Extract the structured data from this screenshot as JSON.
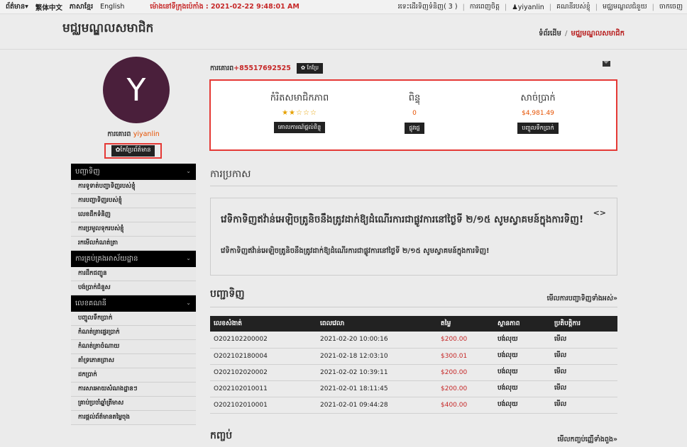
{
  "topbar": {
    "member_center": "ព័ត៌មាន▾",
    "lang_zh": "繁体中文",
    "lang_km": "ភាសាខ្មែរ",
    "lang_en": "English",
    "server_time": "ម៉ោងនៅទីក្រុងប៉េកាំង : 2021-02-22 9:48:01 AM",
    "cart": "រទេះដើរទិញទំនិញ( 3 )",
    "my_favorites": "ការពេញចិត្ត",
    "user": "yiyanlin",
    "account": "គណនីរបស់ខ្ញុំ",
    "service": "មជ្ឈមណ្ឌលជំនួយ",
    "logout": "ចាកចេញ"
  },
  "header": {
    "title": "មជ្ឈមណ្ឌលសមាជិក",
    "crumb_home": "ទំព័រដើម",
    "crumb_current": "មជ្ឈមណ្ឌលសមាជិក"
  },
  "profile": {
    "avatar_letter": "Y",
    "welcome": "ការគោរព",
    "username": "yiyanlin",
    "edit_label": "✿កែប្រែព័ត៌មាន",
    "phone_label": "ការគោរព",
    "phone": "+85517692525",
    "modify_label": "✿ កែប្រែ"
  },
  "stats": [
    {
      "label": "កំរិតសមាជិកភាព",
      "stars": "★★☆☆☆",
      "button": "គោលការណ៍ផ្ដល់ពិន្ទុ"
    },
    {
      "label": "ពិន្ទុ",
      "value": "0",
      "button": "ផ្លូវផ្ទេ"
    },
    {
      "label": "សាច់ប្រាក់",
      "value": "$4,981.49",
      "button": "បញ្ចូលទឹកប្រាក់"
    }
  ],
  "menu": [
    {
      "group": "បញ្ជាទិញ",
      "items": [
        "ការទូទាត់បញ្ជាទិញរបស់ខ្ញុំ",
        "ការបញ្ជាទិញរបស់ខ្ញុំ",
        "លេខដឹកទំនិញ",
        "ការប្រមូលទុករបស់ខ្ញុំ",
        "រកមើលកំណត់ត្រា"
      ]
    },
    {
      "group": "ការគ្រប់គ្រងអាស័យដ្ឋាន",
      "items": [
        "ការដឹកជញ្ជូន",
        "បង់ប្រាក់ជំនួស"
      ]
    },
    {
      "group": "លេខគណនី",
      "items": [
        "បញ្ចូលទឹកប្រាក់",
        "កំណត់ត្រាផ្ទេរប្រាក់",
        "កំណត់ត្រាចំណាយ",
        "គាំទ្រភោគព្រាស",
        "ដកប្រាក់",
        "ការសារអាយសំណងដ្ឋានៗ",
        "គ្រាប់ប្រចាំឆ្នាំត្រីមាស",
        "ការផ្ដល់ព័ត៌មានតម្លៃចុង"
      ]
    }
  ],
  "announcement": {
    "heading": "ការប្រកាស",
    "nav": "<>",
    "title": "វេទិកាទិញឥវ៉ាន់អេឡិចត្រូនិចនឹងត្រូវដាក់ឱ្យដំណើរការជាផ្លូវការនៅថ្ងៃទី ២/១៥ សូមស្វាគមន៍ក្នុងការទិញ!",
    "body": "វេទិកាទិញឥវ៉ាន់អេឡិចត្រូនិចនឹងត្រូវដាក់ឱ្យដំណើរការជាផ្លូវការនៅថ្ងៃទី ២/១៥ សូមស្វាគមន៍ក្នុងការទិញ!"
  },
  "orders": {
    "heading": "បញ្ជាទិញ",
    "view_all": "មើលការបញ្ជាទិញទាំងអស់»",
    "columns": [
      "លេខសំងាត់",
      "ពេលវេលា",
      "តម្លៃ",
      "ស្ថានភាព",
      "ប្រតិបត្តិការ"
    ],
    "rows": [
      [
        "O202102200002",
        "2021-02-20 10:00:16",
        "$200.00",
        "បង់លុយ",
        "មើល"
      ],
      [
        "O202102180004",
        "2021-02-18 12:03:10",
        "$300.01",
        "បង់លុយ",
        "មើល"
      ],
      [
        "O202102020002",
        "2021-02-02 10:39:11",
        "$200.00",
        "បង់លុយ",
        "មើល"
      ],
      [
        "O202102010011",
        "2021-02-01 18:11:45",
        "$200.00",
        "បង់លុយ",
        "មើល"
      ],
      [
        "O202102010001",
        "2021-02-01 09:44:28",
        "$400.00",
        "បង់លុយ",
        "មើល"
      ]
    ]
  },
  "refund": {
    "heading": "កញ្ចប់",
    "view_all": "មើលកញ្ចប់ញ្ញើទាំងពួង»"
  },
  "colors": {
    "accent": "#c62828",
    "highlight_border": "#e53935",
    "avatar_bg": "#4a1f3b"
  }
}
